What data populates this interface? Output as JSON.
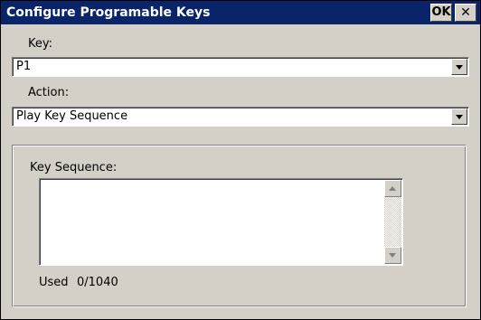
{
  "window": {
    "title": "Configure Programable Keys",
    "ok_label": "OK",
    "close_glyph": "✕"
  },
  "key_field": {
    "label": "Key:",
    "value": "P1"
  },
  "action_field": {
    "label": "Action:",
    "value": "Play Key Sequence"
  },
  "sequence_group": {
    "label": "Key Sequence:",
    "value": "",
    "used_label": "Used",
    "used_value": "0/1040"
  },
  "colors": {
    "titlebar": "#0a246a",
    "dialog_face": "#d4d0c8"
  },
  "icons": [
    "dropdown-arrow-icon",
    "scroll-up-arrow-icon",
    "scroll-down-arrow-icon",
    "close-icon"
  ]
}
